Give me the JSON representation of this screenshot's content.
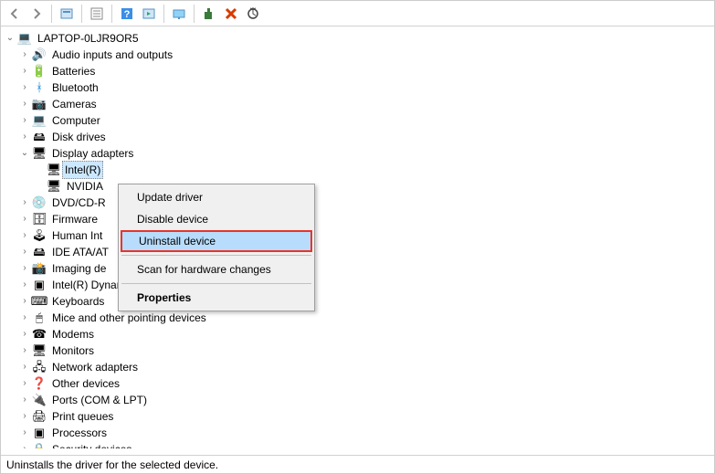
{
  "toolbar": {
    "back": "back",
    "forward": "forward",
    "show_hidden": "show-hidden",
    "properties": "properties",
    "help": "help",
    "action": "action",
    "view": "view",
    "add": "add-legacy",
    "remove": "remove",
    "scan": "scan"
  },
  "root": {
    "label": "LAPTOP-0LJR9OR5",
    "expanded": true
  },
  "categories": [
    {
      "label": "Audio inputs and outputs",
      "expanded": false,
      "icon": "🔊"
    },
    {
      "label": "Batteries",
      "expanded": false,
      "icon": "🔋"
    },
    {
      "label": "Bluetooth",
      "expanded": false,
      "icon": "ᚼ",
      "iconColor": "#0078d7"
    },
    {
      "label": "Cameras",
      "expanded": false,
      "icon": "📷"
    },
    {
      "label": "Computer",
      "expanded": false,
      "icon": "💻"
    },
    {
      "label": "Disk drives",
      "expanded": false,
      "icon": "🖴"
    },
    {
      "label": "Display adapters",
      "expanded": true,
      "icon": "🖥",
      "children": [
        {
          "label": "Intel(R)",
          "icon": "🖥",
          "selected": true
        },
        {
          "label": "NVIDIA",
          "icon": "🖥"
        }
      ]
    },
    {
      "label": "DVD/CD-R",
      "expanded": false,
      "icon": "💿",
      "truncated": true
    },
    {
      "label": "Firmware",
      "expanded": false,
      "icon": "🗄"
    },
    {
      "label": "Human Int",
      "expanded": false,
      "icon": "🕹",
      "truncated": true
    },
    {
      "label": "IDE ATA/AT",
      "expanded": false,
      "icon": "🖴",
      "truncated": true
    },
    {
      "label": "Imaging de",
      "expanded": false,
      "icon": "📸",
      "truncated": true
    },
    {
      "label": "Intel(R) Dynamic Platform and Thermal Framework",
      "expanded": false,
      "icon": "▣"
    },
    {
      "label": "Keyboards",
      "expanded": false,
      "icon": "⌨"
    },
    {
      "label": "Mice and other pointing devices",
      "expanded": false,
      "icon": "🖱"
    },
    {
      "label": "Modems",
      "expanded": false,
      "icon": "☎"
    },
    {
      "label": "Monitors",
      "expanded": false,
      "icon": "🖥"
    },
    {
      "label": "Network adapters",
      "expanded": false,
      "icon": "🖧"
    },
    {
      "label": "Other devices",
      "expanded": false,
      "icon": "❓"
    },
    {
      "label": "Ports (COM & LPT)",
      "expanded": false,
      "icon": "🔌"
    },
    {
      "label": "Print queues",
      "expanded": false,
      "icon": "🖨"
    },
    {
      "label": "Processors",
      "expanded": false,
      "icon": "▣"
    },
    {
      "label": "Security devices",
      "expanded": false,
      "icon": "🔒",
      "cut": true
    }
  ],
  "context_menu": [
    {
      "label": "Update driver",
      "type": "item"
    },
    {
      "label": "Disable device",
      "type": "item"
    },
    {
      "label": "Uninstall device",
      "type": "item",
      "highlighted": true
    },
    {
      "type": "sep"
    },
    {
      "label": "Scan for hardware changes",
      "type": "item"
    },
    {
      "type": "sep"
    },
    {
      "label": "Properties",
      "type": "item",
      "bold": true
    }
  ],
  "status_bar": "Uninstalls the driver for the selected device."
}
